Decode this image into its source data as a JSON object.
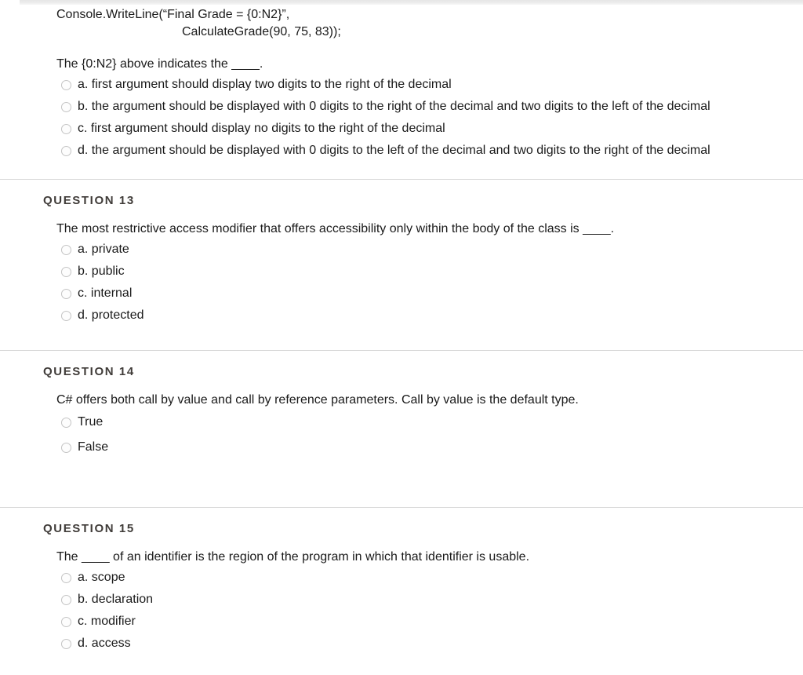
{
  "page": {
    "top_bar": "scroll-gradient-bar"
  },
  "questions": [
    {
      "id": "q12",
      "header": "",
      "has_header": false,
      "has_divider": false,
      "code": {
        "line1": "Console.WriteLine(“Final Grade = {0:N2}”,",
        "line2": "CalculateGrade(90, 75, 83));"
      },
      "text": "The {0:N2} above indicates the ____.",
      "options": [
        {
          "label": "a. first argument should display two digits to the right of the decimal"
        },
        {
          "label": "b. the argument should be displayed with 0 digits to the right of the decimal and two digits to the left of the decimal"
        },
        {
          "label": "c. first argument should display no digits to the right of the decimal"
        },
        {
          "label": "d. the argument should be displayed with 0 digits to the left of the decimal and two digits to the right of the decimal"
        }
      ]
    },
    {
      "id": "q13",
      "header": "QUESTION 13",
      "has_header": true,
      "has_divider": true,
      "text": "The most restrictive access modifier that offers accessibility only within the body of the class is ____.",
      "options": [
        {
          "label": "a. private"
        },
        {
          "label": "b. public"
        },
        {
          "label": "c. internal"
        },
        {
          "label": "d. protected"
        }
      ]
    },
    {
      "id": "q14",
      "header": "QUESTION 14",
      "has_header": true,
      "has_divider": true,
      "text": "C# offers both call by value and call by reference parameters. Call by value is the default type.",
      "options": [
        {
          "label": "True"
        },
        {
          "label": "False"
        }
      ]
    },
    {
      "id": "q15",
      "header": "QUESTION 15",
      "has_header": true,
      "has_divider": true,
      "text": "The ____ of an identifier is the region of the program in which that identifier is usable.",
      "options": [
        {
          "label": "a. scope"
        },
        {
          "label": "b. declaration"
        },
        {
          "label": "c. modifier"
        },
        {
          "label": "d. access"
        }
      ]
    }
  ],
  "colors": {
    "text": "#1a1a1a",
    "header": "#403c39",
    "divider": "#d8d8d8",
    "radio_border": "#c4c4c4",
    "top_bar": "#e6e6e6"
  }
}
